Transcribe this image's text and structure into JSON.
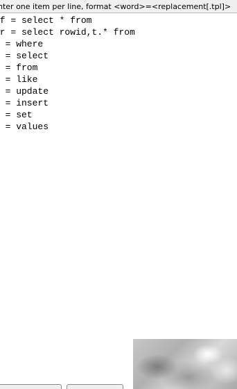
{
  "hint": "nter one item per line, format <word>=<replacement[.tpl]>",
  "lines": [
    "sf = select * from",
    "sr = select rowid,t.* from",
    "w = where",
    "s = select",
    "f = from",
    "l = like",
    "u = update",
    "i = insert",
    "s = set",
    "v = values"
  ],
  "buttons": {
    "left_label": "",
    "right_label": ""
  }
}
